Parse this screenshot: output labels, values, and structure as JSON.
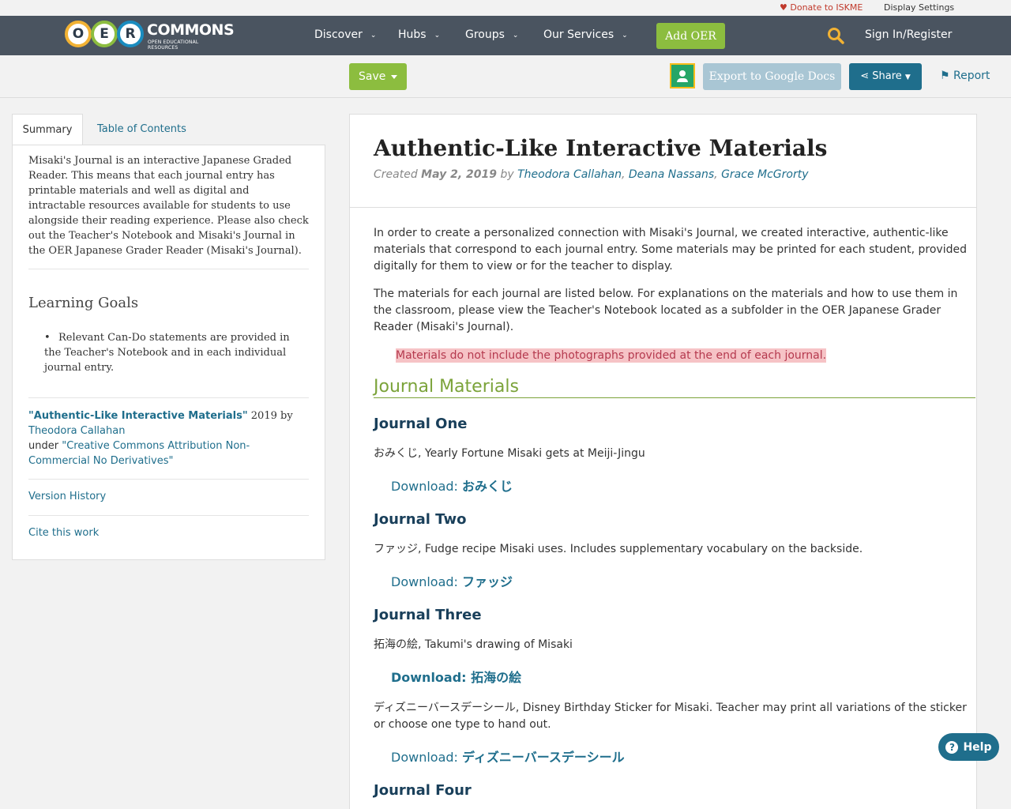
{
  "utility": {
    "donate": "Donate to ISKME",
    "display_settings": "Display Settings",
    "heart_color": "#c0392b"
  },
  "nav": {
    "logo": {
      "letters": [
        "O",
        "E",
        "R"
      ],
      "word": "COMMONS",
      "subtitle": "OPEN EDUCATIONAL RESOURCES"
    },
    "items": [
      "Discover",
      "Hubs",
      "Groups",
      "Our Services"
    ],
    "add_oer": "Add OER",
    "sign_in": "Sign In/Register"
  },
  "actions": {
    "save": "Save",
    "export": "Export to Google Docs",
    "share": "Share",
    "report": "Report"
  },
  "sidebar": {
    "tabs": [
      "Summary",
      "Table of Contents"
    ],
    "description": "Misaki's Journal is an interactive Japanese Graded Reader. This means that each journal entry has printable materials and well as digital and intractable resources available for students to use alongside their reading experience. Please also check out the Teacher's Notebook and Misaki's Journal in the OER Japanese Grader Reader (Misaki's Journal).",
    "learning_goals_title": "Learning Goals",
    "learning_goals": [
      "Relevant Can-Do statements are provided in the Teacher's Notebook and in each individual journal entry."
    ],
    "license": {
      "title": "\"Authentic-Like Interactive Materials\"",
      "year": "2019 by",
      "author": "Theodora Callahan",
      "under": "under",
      "license_name": "\"Creative Commons Attribution Non-Commercial No Derivatives\""
    },
    "version_history": "Version History",
    "cite": "Cite this work"
  },
  "main": {
    "title": "Authentic-Like Interactive Materials",
    "created_label": "Created",
    "created_date": "May 2, 2019",
    "by": "by",
    "authors": [
      "Theodora Callahan",
      "Deana Nassans",
      "Grace McGrorty"
    ],
    "para1": "In order to create a personalized connection with Misaki's Journal, we created interactive, authentic-like materials that correspond to each journal entry. Some materials may be printed for each student, provided digitally for them to view or for the teacher to display.",
    "para2": "The materials for each journal are listed below. For explanations on the materials and how to use them in the classroom, please view the Teacher's Notebook located as a subfolder in the OER Japanese Grader Reader (Misaki's Journal).",
    "note": "Materials do not include the photographs provided at the end of each journal.",
    "section_title": "Journal Materials",
    "journals": [
      {
        "title": "Journal One",
        "desc": "おみくじ, Yearly Fortune Misaki gets at Meiji-Jingu",
        "dl_prefix": "Download: ",
        "dl_name": "おみくじ"
      },
      {
        "title": "Journal Two",
        "desc": "ファッジ, Fudge recipe Misaki uses. Includes supplementary vocabulary on the backside.",
        "dl_prefix": "Download: ",
        "dl_name": "ファッジ"
      },
      {
        "title": "Journal Three",
        "desc": "拓海の絵, Takumi's drawing of Misaki",
        "dl_prefix": "Download: ",
        "dl_name": "拓海の絵"
      },
      {
        "title": "",
        "desc": "ディズニーバースデーシール, Disney Birthday Sticker for Misaki. Teacher may print all variations of the sticker or choose one type to hand out.",
        "dl_prefix": "Download: ",
        "dl_name": "ディズニーバースデーシール"
      },
      {
        "title": "Journal Four"
      }
    ]
  },
  "help": "Help",
  "colors": {
    "nav_bg": "#4a5460",
    "green": "#8cbd3f",
    "link_blue": "#1f6e8c",
    "section_green": "#7ba33a",
    "note_bg": "#f6c3c6"
  }
}
